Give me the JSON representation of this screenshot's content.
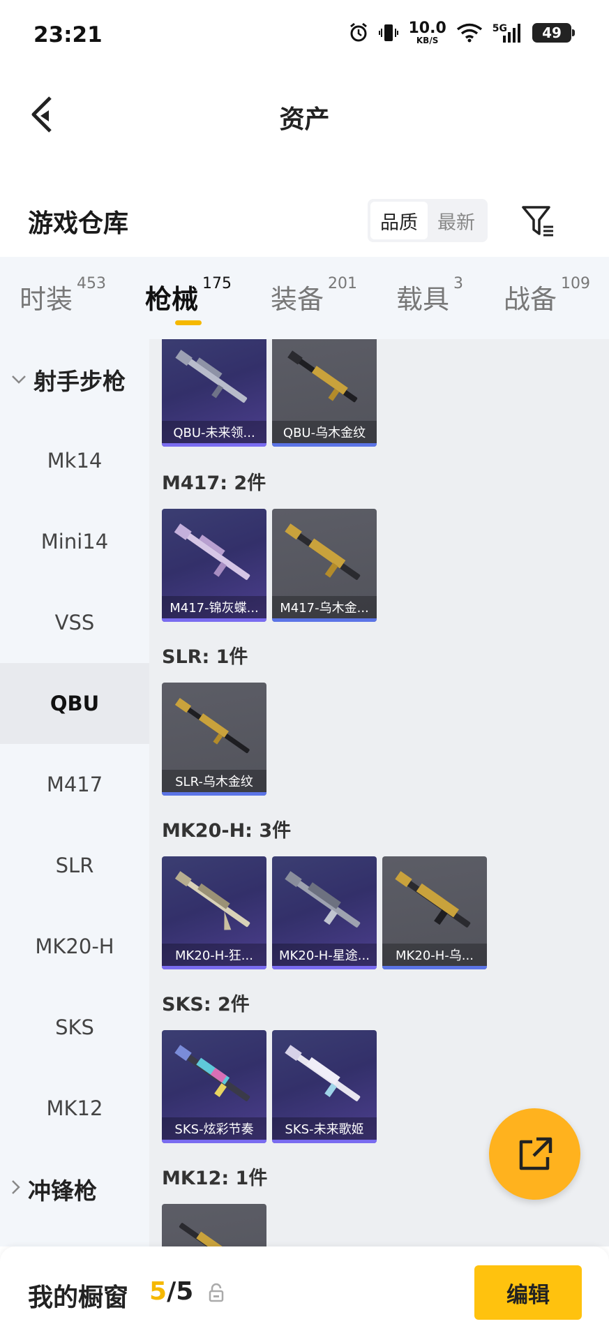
{
  "status_bar": {
    "time": "23:21",
    "net_speed": "10.0",
    "net_unit": "KB/S",
    "network": "5G",
    "battery": "49",
    "icons": [
      "alarm-icon",
      "vibrate-icon",
      "wifi-icon",
      "signal-icon",
      "battery-icon"
    ]
  },
  "header": {
    "title": "资产",
    "back_icon": "chevron-left-icon"
  },
  "section": {
    "title": "游戏仓库",
    "sort_options": [
      "品质",
      "最新"
    ],
    "sort_selected": "品质",
    "filter_icon": "filter-icon"
  },
  "tabs": [
    {
      "label": "时装",
      "count": "453"
    },
    {
      "label": "枪械",
      "count": "175",
      "active": true
    },
    {
      "label": "装备",
      "count": "201"
    },
    {
      "label": "载具",
      "count": "3"
    },
    {
      "label": "战备",
      "count": "109"
    }
  ],
  "sidebar": {
    "group_open": "射手步枪",
    "items": [
      "Mk14",
      "Mini14",
      "VSS",
      "QBU",
      "M417",
      "SLR",
      "MK20-H",
      "SKS",
      "MK12"
    ],
    "active_item": "QBU",
    "group_closed": "冲锋枪"
  },
  "content": {
    "groups": [
      {
        "label": "",
        "items": [
          {
            "name": "QBU-未来领...",
            "style": "purple"
          },
          {
            "name": "QBU-乌木金纹",
            "style": "gray"
          }
        ]
      },
      {
        "label": "M417: 2件",
        "items": [
          {
            "name": "M417-锦灰蝶...",
            "style": "purple"
          },
          {
            "name": "M417-乌木金...",
            "style": "gray"
          }
        ]
      },
      {
        "label": "SLR: 1件",
        "items": [
          {
            "name": "SLR-乌木金纹",
            "style": "gray"
          }
        ]
      },
      {
        "label": "MK20-H: 3件",
        "items": [
          {
            "name": "MK20-H-狂...",
            "style": "purple"
          },
          {
            "name": "MK20-H-星途...",
            "style": "purple"
          },
          {
            "name": "MK20-H-乌...",
            "style": "gray"
          }
        ]
      },
      {
        "label": "SKS: 2件",
        "items": [
          {
            "name": "SKS-炫彩节奏",
            "style": "purple"
          },
          {
            "name": "SKS-未来歌姬",
            "style": "purple"
          }
        ]
      },
      {
        "label": "MK12: 1件",
        "items": [
          {
            "name": "",
            "style": "gray"
          }
        ]
      }
    ]
  },
  "fab": {
    "icon": "share-external-icon"
  },
  "bottom_bar": {
    "label": "我的橱窗",
    "count_current": "5",
    "count_sep": "/",
    "count_total": "5",
    "lock_icon": "lock-icon",
    "edit_label": "编辑"
  },
  "colors": {
    "accent": "#f5b800",
    "button": "#ffc20e",
    "fab": "#ffb21e",
    "purple_card": "#3b3e72",
    "gray_card": "#5c5d66",
    "rarity_bar": "#5b74e6"
  }
}
